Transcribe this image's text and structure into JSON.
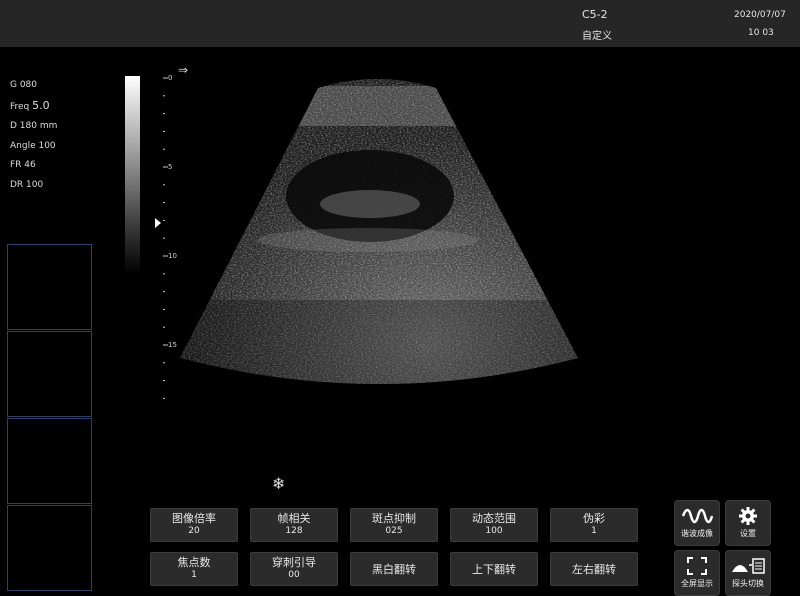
{
  "header": {
    "probe": "C5-2",
    "preset": "自定义",
    "date": "2020/07/07",
    "time": "10 03"
  },
  "params": {
    "gain": "G 080",
    "freq_label": "Freq",
    "freq_value": "5.0",
    "depth": "D 180 mm",
    "angle": "Angle 100",
    "frame_rate": "FR 46",
    "dynamic_range": "DR 100"
  },
  "depth_scale": [
    "0",
    "5",
    "10",
    "15"
  ],
  "freeze_icon": "snowflake-icon",
  "buttons_row1": [
    {
      "label": "图像倍率",
      "value": "20"
    },
    {
      "label": "帧相关",
      "value": "128"
    },
    {
      "label": "斑点抑制",
      "value": "025"
    },
    {
      "label": "动态范围",
      "value": "100"
    },
    {
      "label": "伪彩",
      "value": "1"
    }
  ],
  "buttons_row2": [
    {
      "label": "焦点数",
      "value": "1"
    },
    {
      "label": "穿刺引导",
      "value": "00"
    },
    {
      "label": "黑白翻转"
    },
    {
      "label": "上下翻转"
    },
    {
      "label": "左右翻转"
    }
  ],
  "side_buttons": {
    "harmonic": "谐波成像",
    "settings": "设置",
    "fullscreen": "全屏显示",
    "probe_switch": "探头切换"
  }
}
